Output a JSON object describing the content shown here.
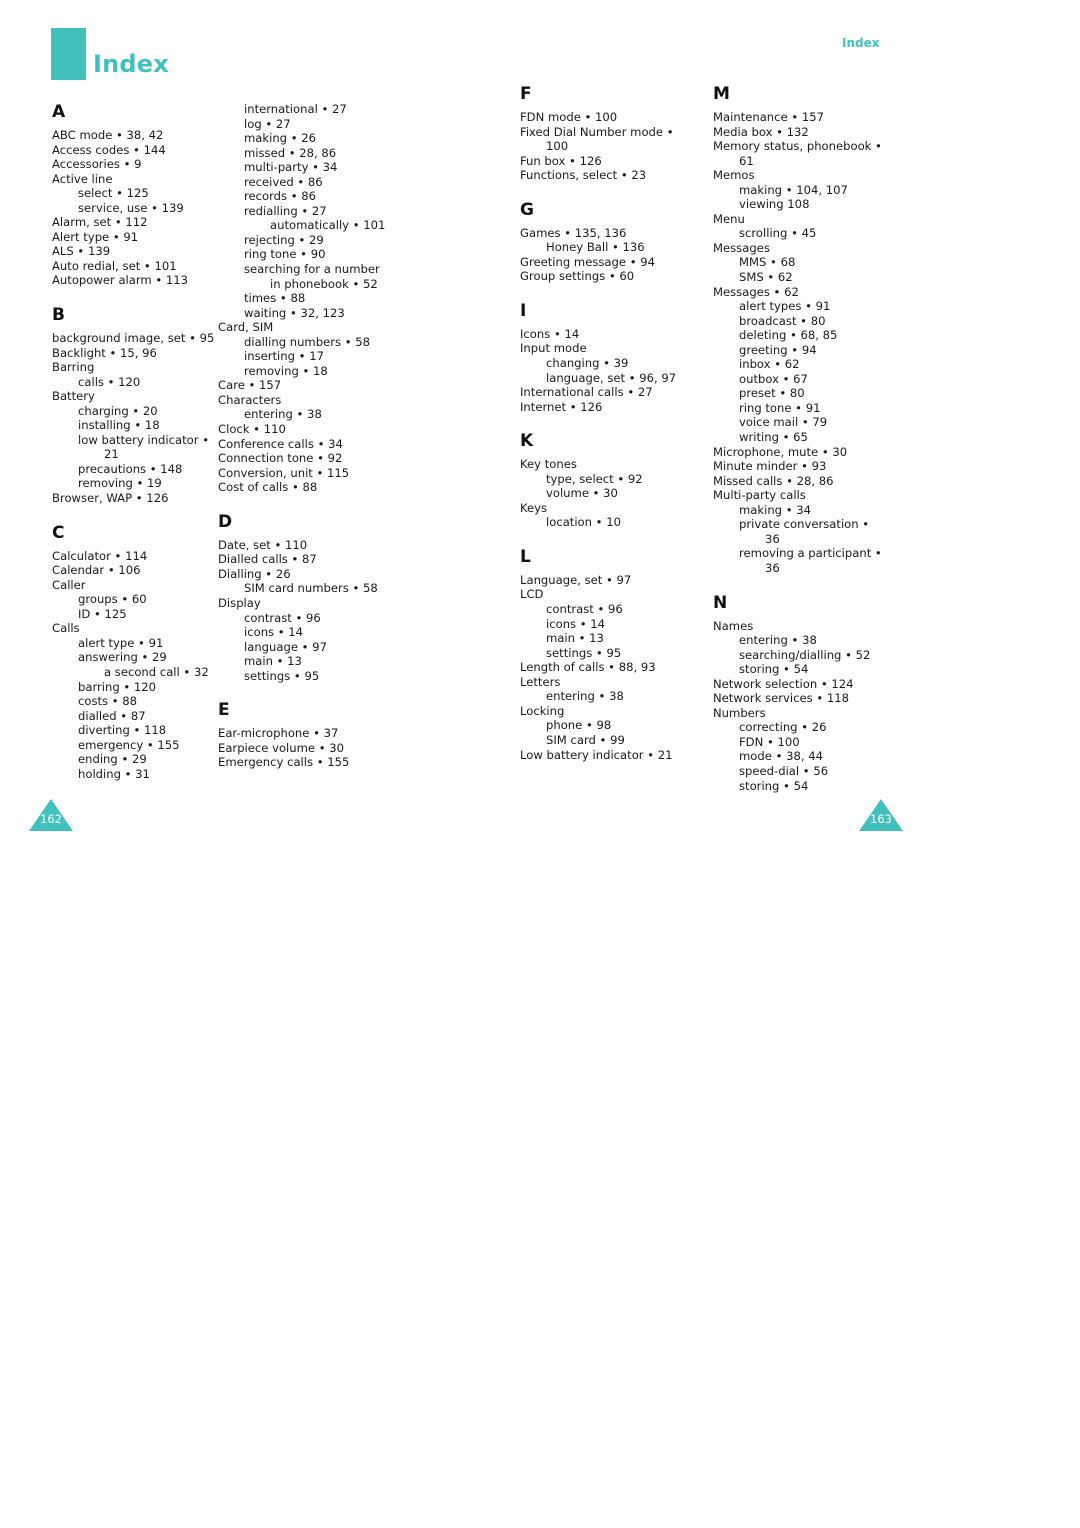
{
  "header": {
    "title": "Index",
    "running_head": "Index"
  },
  "colors": {
    "accent": "#41c0bd"
  },
  "columns": [
    {
      "sections": [
        {
          "letter": "A",
          "entries": [
            {
              "text": "ABC mode • 38, 42",
              "level": 0
            },
            {
              "text": "Access codes • 144",
              "level": 0
            },
            {
              "text": "Accessories • 9",
              "level": 0
            },
            {
              "text": "Active line",
              "level": 0
            },
            {
              "text": "select • 125",
              "level": 1
            },
            {
              "text": "service, use • 139",
              "level": 1
            },
            {
              "text": "Alarm, set • 112",
              "level": 0
            },
            {
              "text": "Alert type • 91",
              "level": 0
            },
            {
              "text": "ALS • 139",
              "level": 0
            },
            {
              "text": "Auto redial, set • 101",
              "level": 0
            },
            {
              "text": "Autopower alarm • 113",
              "level": 0
            }
          ]
        },
        {
          "letter": "B",
          "entries": [
            {
              "text": "background image, set • 95",
              "level": 0
            },
            {
              "text": "Backlight • 15, 96",
              "level": 0
            },
            {
              "text": "Barring",
              "level": 0
            },
            {
              "text": "calls • 120",
              "level": 1
            },
            {
              "text": "Battery",
              "level": 0
            },
            {
              "text": "charging • 20",
              "level": 1
            },
            {
              "text": "installing • 18",
              "level": 1
            },
            {
              "text": "low battery indicator •",
              "level": 1
            },
            {
              "text": "21",
              "level": 2
            },
            {
              "text": "precautions • 148",
              "level": 1
            },
            {
              "text": "removing • 19",
              "level": 1
            },
            {
              "text": "Browser, WAP • 126",
              "level": 0
            }
          ]
        },
        {
          "letter": "C",
          "entries": [
            {
              "text": "Calculator • 114",
              "level": 0
            },
            {
              "text": "Calendar • 106",
              "level": 0
            },
            {
              "text": "Caller",
              "level": 0
            },
            {
              "text": "groups • 60",
              "level": 1
            },
            {
              "text": "ID • 125",
              "level": 1
            },
            {
              "text": "Calls",
              "level": 0
            },
            {
              "text": "alert type • 91",
              "level": 1
            },
            {
              "text": "answering • 29",
              "level": 1
            },
            {
              "text": "a second call • 32",
              "level": 2
            },
            {
              "text": "barring • 120",
              "level": 1
            },
            {
              "text": "costs • 88",
              "level": 1
            },
            {
              "text": "dialled • 87",
              "level": 1
            },
            {
              "text": "diverting • 118",
              "level": 1
            },
            {
              "text": "emergency • 155",
              "level": 1
            },
            {
              "text": "ending • 29",
              "level": 1
            },
            {
              "text": "holding • 31",
              "level": 1
            }
          ]
        }
      ]
    },
    {
      "sections": [
        {
          "letter": "",
          "entries": [
            {
              "text": "international • 27",
              "level": 1
            },
            {
              "text": "log • 27",
              "level": 1
            },
            {
              "text": "making • 26",
              "level": 1
            },
            {
              "text": "missed • 28, 86",
              "level": 1
            },
            {
              "text": "multi-party • 34",
              "level": 1
            },
            {
              "text": "received • 86",
              "level": 1
            },
            {
              "text": "records • 86",
              "level": 1
            },
            {
              "text": "redialling • 27",
              "level": 1
            },
            {
              "text": "automatically • 101",
              "level": 2
            },
            {
              "text": "rejecting • 29",
              "level": 1
            },
            {
              "text": "ring tone • 90",
              "level": 1
            },
            {
              "text": "searching for a number",
              "level": 1
            },
            {
              "text": "in phonebook • 52",
              "level": 2
            },
            {
              "text": "times • 88",
              "level": 1
            },
            {
              "text": "waiting • 32, 123",
              "level": 1
            },
            {
              "text": "Card, SIM",
              "level": 0
            },
            {
              "text": "dialling numbers • 58",
              "level": 1
            },
            {
              "text": "inserting • 17",
              "level": 1
            },
            {
              "text": "removing • 18",
              "level": 1
            },
            {
              "text": "Care • 157",
              "level": 0
            },
            {
              "text": "Characters",
              "level": 0
            },
            {
              "text": "entering • 38",
              "level": 1
            },
            {
              "text": "Clock • 110",
              "level": 0
            },
            {
              "text": "Conference calls • 34",
              "level": 0
            },
            {
              "text": "Connection tone • 92",
              "level": 0
            },
            {
              "text": "Conversion, unit • 115",
              "level": 0
            },
            {
              "text": "Cost of calls • 88",
              "level": 0
            }
          ]
        },
        {
          "letter": "D",
          "entries": [
            {
              "text": "Date, set • 110",
              "level": 0
            },
            {
              "text": "Dialled calls • 87",
              "level": 0
            },
            {
              "text": "Dialling • 26",
              "level": 0
            },
            {
              "text": "SIM card numbers • 58",
              "level": 1
            },
            {
              "text": "Display",
              "level": 0
            },
            {
              "text": "contrast • 96",
              "level": 1
            },
            {
              "text": "icons • 14",
              "level": 1
            },
            {
              "text": "language • 97",
              "level": 1
            },
            {
              "text": "main • 13",
              "level": 1
            },
            {
              "text": "settings • 95",
              "level": 1
            }
          ]
        },
        {
          "letter": "E",
          "entries": [
            {
              "text": "Ear-microphone • 37",
              "level": 0
            },
            {
              "text": "Earpiece volume • 30",
              "level": 0
            },
            {
              "text": "Emergency calls • 155",
              "level": 0
            }
          ]
        }
      ]
    },
    {
      "sections": [
        {
          "letter": "F",
          "entries": [
            {
              "text": "FDN mode • 100",
              "level": 0
            },
            {
              "text": "Fixed Dial Number mode •",
              "level": 0
            },
            {
              "text": "100",
              "level": 1
            },
            {
              "text": "Fun box • 126",
              "level": 0
            },
            {
              "text": "Functions, select • 23",
              "level": 0
            }
          ]
        },
        {
          "letter": "G",
          "entries": [
            {
              "text": "Games • 135, 136",
              "level": 0
            },
            {
              "text": "Honey Ball • 136",
              "level": 1
            },
            {
              "text": "Greeting message • 94",
              "level": 0
            },
            {
              "text": "Group settings • 60",
              "level": 0
            }
          ]
        },
        {
          "letter": "I",
          "entries": [
            {
              "text": "Icons • 14",
              "level": 0
            },
            {
              "text": "Input mode",
              "level": 0
            },
            {
              "text": "changing • 39",
              "level": 1
            },
            {
              "text": "language, set • 96, 97",
              "level": 1
            },
            {
              "text": "International calls • 27",
              "level": 0
            },
            {
              "text": "Internet • 126",
              "level": 0
            }
          ]
        },
        {
          "letter": "K",
          "entries": [
            {
              "text": "Key tones",
              "level": 0
            },
            {
              "text": "type, select • 92",
              "level": 1
            },
            {
              "text": "volume • 30",
              "level": 1
            },
            {
              "text": "Keys",
              "level": 0
            },
            {
              "text": "location • 10",
              "level": 1
            }
          ]
        },
        {
          "letter": "L",
          "entries": [
            {
              "text": "Language, set • 97",
              "level": 0
            },
            {
              "text": "LCD",
              "level": 0
            },
            {
              "text": "contrast • 96",
              "level": 1
            },
            {
              "text": "icons • 14",
              "level": 1
            },
            {
              "text": "main • 13",
              "level": 1
            },
            {
              "text": "settings • 95",
              "level": 1
            },
            {
              "text": "Length of calls • 88, 93",
              "level": 0
            },
            {
              "text": "Letters",
              "level": 0
            },
            {
              "text": "entering • 38",
              "level": 1
            },
            {
              "text": "Locking",
              "level": 0
            },
            {
              "text": "phone • 98",
              "level": 1
            },
            {
              "text": "SIM card • 99",
              "level": 1
            },
            {
              "text": "Low battery indicator • 21",
              "level": 0
            }
          ]
        }
      ]
    },
    {
      "sections": [
        {
          "letter": "M",
          "entries": [
            {
              "text": "Maintenance • 157",
              "level": 0
            },
            {
              "text": "Media box • 132",
              "level": 0
            },
            {
              "text": "Memory status, phonebook •",
              "level": 0
            },
            {
              "text": "61",
              "level": 1
            },
            {
              "text": "Memos",
              "level": 0
            },
            {
              "text": "making • 104, 107",
              "level": 1
            },
            {
              "text": "viewing 108",
              "level": 1
            },
            {
              "text": "Menu",
              "level": 0
            },
            {
              "text": "scrolling • 45",
              "level": 1
            },
            {
              "text": "Messages",
              "level": 0
            },
            {
              "text": "MMS • 68",
              "level": 1
            },
            {
              "text": "SMS • 62",
              "level": 1
            },
            {
              "text": "Messages • 62",
              "level": 0
            },
            {
              "text": "alert types • 91",
              "level": 1
            },
            {
              "text": "broadcast • 80",
              "level": 1
            },
            {
              "text": "deleting • 68, 85",
              "level": 1
            },
            {
              "text": "greeting • 94",
              "level": 1
            },
            {
              "text": "inbox • 62",
              "level": 1
            },
            {
              "text": "outbox • 67",
              "level": 1
            },
            {
              "text": "preset • 80",
              "level": 1
            },
            {
              "text": "ring tone • 91",
              "level": 1
            },
            {
              "text": "voice mail • 79",
              "level": 1
            },
            {
              "text": "writing • 65",
              "level": 1
            },
            {
              "text": "Microphone, mute • 30",
              "level": 0
            },
            {
              "text": "Minute minder • 93",
              "level": 0
            },
            {
              "text": "Missed calls • 28, 86",
              "level": 0
            },
            {
              "text": "Multi-party calls",
              "level": 0
            },
            {
              "text": "making • 34",
              "level": 1
            },
            {
              "text": "private conversation •",
              "level": 1
            },
            {
              "text": "36",
              "level": 2
            },
            {
              "text": "removing a participant •",
              "level": 1
            },
            {
              "text": "36",
              "level": 2
            }
          ]
        },
        {
          "letter": "N",
          "entries": [
            {
              "text": "Names",
              "level": 0
            },
            {
              "text": "entering • 38",
              "level": 1
            },
            {
              "text": "searching/dialling • 52",
              "level": 1
            },
            {
              "text": "storing • 54",
              "level": 1
            },
            {
              "text": "Network selection • 124",
              "level": 0
            },
            {
              "text": "Network services • 118",
              "level": 0
            },
            {
              "text": "Numbers",
              "level": 0
            },
            {
              "text": "correcting • 26",
              "level": 1
            },
            {
              "text": "FDN • 100",
              "level": 1
            },
            {
              "text": "mode • 38, 44",
              "level": 1
            },
            {
              "text": "speed-dial • 56",
              "level": 1
            },
            {
              "text": "storing • 54",
              "level": 1
            }
          ]
        }
      ]
    }
  ],
  "footer": {
    "left_page_number": "162",
    "right_page_number": "163"
  }
}
